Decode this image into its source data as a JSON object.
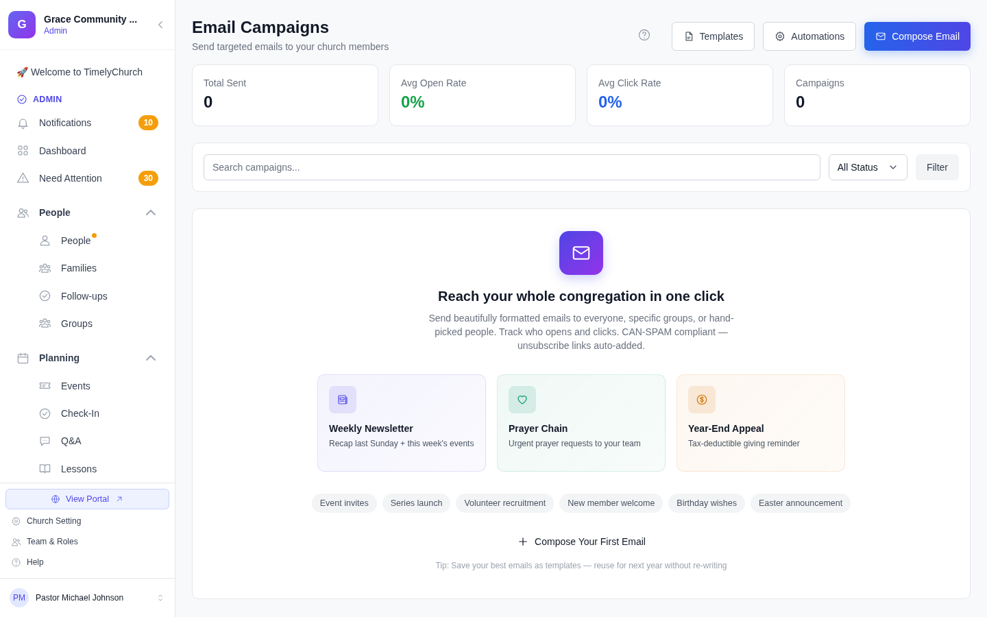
{
  "sidebar": {
    "org": {
      "initial": "G",
      "name": "Grace Community ...",
      "role": "Admin"
    },
    "welcome": "🚀 Welcome to TimelyChurch",
    "section_label": "ADMIN",
    "items": [
      {
        "label": "Notifications",
        "badge": "10"
      },
      {
        "label": "Dashboard"
      },
      {
        "label": "Need Attention",
        "badge": "30"
      }
    ],
    "groups": [
      {
        "label": "People",
        "expanded": true,
        "children": [
          {
            "label": "People",
            "dot": true
          },
          {
            "label": "Families",
            "dot": false
          },
          {
            "label": "Follow-ups",
            "dot": false
          },
          {
            "label": "Groups",
            "dot": false
          }
        ]
      },
      {
        "label": "Planning",
        "expanded": true,
        "children": [
          {
            "label": "Events",
            "dot": false
          },
          {
            "label": "Check-In",
            "dot": false
          },
          {
            "label": "Q&A",
            "dot": false
          },
          {
            "label": "Lessons",
            "dot": false
          }
        ]
      }
    ],
    "portal_button": "View Portal",
    "footer_links": [
      "Church Setting",
      "Team & Roles",
      "Help"
    ],
    "user": {
      "initials": "PM",
      "name": "Pastor Michael Johnson"
    }
  },
  "header": {
    "title": "Email Campaigns",
    "subtitle": "Send targeted emails to your church members",
    "buttons": [
      "Templates",
      "Automations"
    ],
    "primary_button": "Compose Email"
  },
  "stats": [
    {
      "label": "Total Sent",
      "value": "0",
      "color": "#111827"
    },
    {
      "label": "Avg Open Rate",
      "value": "0%",
      "color": "#16a34a"
    },
    {
      "label": "Avg Click Rate",
      "value": "0%",
      "color": "#2563eb"
    },
    {
      "label": "Campaigns",
      "value": "0",
      "color": "#111827"
    }
  ],
  "filters": {
    "search": {
      "placeholder": "Search campaigns..."
    },
    "status": "All Status",
    "button": "Filter"
  },
  "empty_state": {
    "title": "Reach your whole congregation in one click",
    "description": "Send beautifully formatted emails to everyone, specific groups, or hand-picked people. Track who opens and clicks. CAN-SPAM compliant — unsubscribe links auto-added.",
    "templates": [
      {
        "title": "Weekly Newsletter",
        "description": "Recap last Sunday + this week's events",
        "color": "#4f46e5"
      },
      {
        "title": "Prayer Chain",
        "description": "Urgent prayer requests to your team",
        "color": "#059669"
      },
      {
        "title": "Year-End Appeal",
        "description": "Tax-deductible giving reminder",
        "color": "#d97706"
      }
    ],
    "chips": [
      "Event invites",
      "Series launch",
      "Volunteer recruitment",
      "New member welcome",
      "Birthday wishes",
      "Easter announcement"
    ],
    "compose_link": "Compose Your First Email",
    "tip": "Tip: Save your best emails as templates — reuse for next year without re-writing"
  }
}
